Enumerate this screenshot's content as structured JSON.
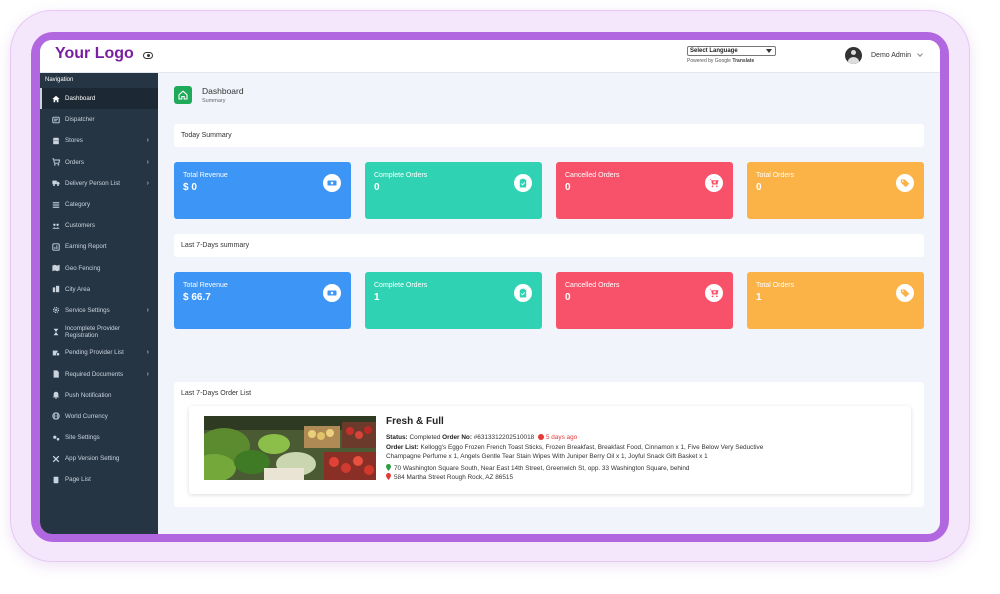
{
  "header": {
    "logo": "Your Logo",
    "language_select": "Select Language",
    "powered_by": "Powered by",
    "google": "Google",
    "translate": "Translate",
    "user_name": "Demo Admin"
  },
  "sidebar": {
    "heading": "Navigation",
    "items": [
      {
        "label": "Dashboard",
        "icon": "home-icon",
        "active": true,
        "arrow": false
      },
      {
        "label": "Dispatcher",
        "icon": "dispatcher-icon",
        "arrow": false
      },
      {
        "label": "Stores",
        "icon": "store-icon",
        "arrow": true
      },
      {
        "label": "Orders",
        "icon": "cart-icon",
        "arrow": true
      },
      {
        "label": "Delivery Person List",
        "icon": "truck-icon",
        "arrow": true
      },
      {
        "label": "Category",
        "icon": "list-icon",
        "arrow": false
      },
      {
        "label": "Customers",
        "icon": "users-icon",
        "arrow": false
      },
      {
        "label": "Earning Report",
        "icon": "report-icon",
        "arrow": false
      },
      {
        "label": "Geo Fencing",
        "icon": "map-icon",
        "arrow": false
      },
      {
        "label": "City Area",
        "icon": "city-icon",
        "arrow": false
      },
      {
        "label": "Service Settings",
        "icon": "gear-icon",
        "arrow": true
      },
      {
        "label": "Incomplete Provider Registration",
        "icon": "hourglass-icon",
        "arrow": false
      },
      {
        "label": "Pending Provider List",
        "icon": "pending-icon",
        "arrow": true
      },
      {
        "label": "Required Documents",
        "icon": "document-icon",
        "arrow": true
      },
      {
        "label": "Push Notification",
        "icon": "bell-icon",
        "arrow": false
      },
      {
        "label": "World Currency",
        "icon": "currency-icon",
        "arrow": false
      },
      {
        "label": "Site Settings",
        "icon": "sliders-icon",
        "arrow": false
      },
      {
        "label": "App Version Setting",
        "icon": "tools-icon",
        "arrow": false
      },
      {
        "label": "Page List",
        "icon": "page-icon",
        "arrow": false
      }
    ]
  },
  "page": {
    "title": "Dashboard",
    "subtitle": "Summary"
  },
  "today": {
    "heading": "Today Summary",
    "cards": [
      {
        "label": "Total Revenue",
        "value": "$ 0",
        "icon": "money-icon",
        "color": "#3d95f5"
      },
      {
        "label": "Complete Orders",
        "value": "0",
        "icon": "clipboard-check-icon",
        "color": "#2fd3b3"
      },
      {
        "label": "Cancelled Orders",
        "value": "0",
        "icon": "cart-x-icon",
        "color": "#f8526a"
      },
      {
        "label": "Total Orders",
        "value": "0",
        "icon": "tags-icon",
        "color": "#fbb246"
      }
    ]
  },
  "week": {
    "heading": "Last 7-Days summary",
    "cards": [
      {
        "label": "Total Revenue",
        "value": "$ 66.7",
        "icon": "money-icon",
        "color": "#3d95f5"
      },
      {
        "label": "Complete Orders",
        "value": "1",
        "icon": "clipboard-check-icon",
        "color": "#2fd3b3"
      },
      {
        "label": "Cancelled Orders",
        "value": "0",
        "icon": "cart-x-icon",
        "color": "#f8526a"
      },
      {
        "label": "Total Orders",
        "value": "1",
        "icon": "tags-icon",
        "color": "#fbb246"
      }
    ]
  },
  "orders": {
    "heading": "Last 7-Days Order List",
    "items": [
      {
        "store": "Fresh & Full",
        "status_label": "Status:",
        "status": "Completed",
        "order_no_label": "Order No:",
        "order_no": "#6313312202510018",
        "age": "5 days ago",
        "order_list_label": "Order List:",
        "order_list_line1": "Kellogg's Eggo Frozen French Toast Sticks, Frozen Breakfast, Breakfast Food, Cinnamon x 1, Five Below Very Seductive",
        "order_list_line2": "Champagne Perfume x 1, Angels Gentle Tear Stain Wipes With Juniper Berry Oil x 1, Joyful Snack Gift Basket x 1",
        "pickup_address": "70 Washington Square South, Near East 14th Street, Greenwich St, opp. 33 Washington Square, behind",
        "drop_address": "584 Martha Street Rough Rock, AZ 86515"
      }
    ]
  }
}
